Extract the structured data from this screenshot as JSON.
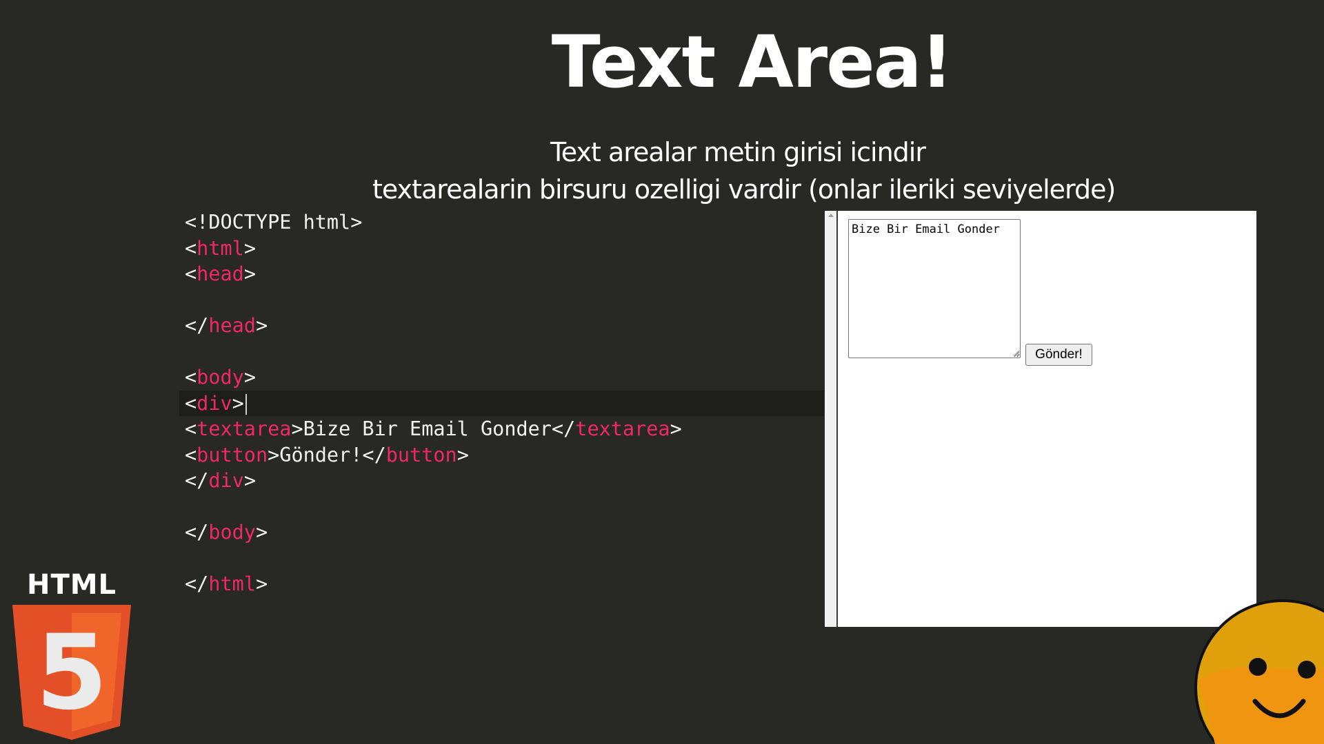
{
  "slide": {
    "title": "Text Area!",
    "subtitle_line1": "Text arealar metin girisi icindir",
    "subtitle_line2": "textarealarin birsuru ozelligi vardir (onlar ileriki seviyelerde)"
  },
  "code": {
    "doctype": "<!DOCTYPE html>",
    "open_bracket": "<",
    "close_bracket": ">",
    "end_open_bracket": "</",
    "tag_html": "html",
    "tag_head": "head",
    "tag_body": "body",
    "tag_div": "div",
    "tag_textarea": "textarea",
    "tag_button": "button",
    "textarea_content": "Bize Bir Email Gonder",
    "button_content": "Gönder!"
  },
  "preview": {
    "textarea_value": "Bize Bir Email Gonder",
    "button_label": "Gönder!"
  },
  "logo": {
    "word": "HTML",
    "number": "5",
    "colors": {
      "shield_dark": "#e34f26",
      "shield_light": "#ef652a",
      "five": "#ebebeb"
    }
  },
  "mascot": {
    "icon": "smiley-face-icon",
    "color": "#f0950f"
  },
  "colors": {
    "background": "#282824",
    "tag": "#f0286a",
    "text": "#f2f2f2"
  }
}
